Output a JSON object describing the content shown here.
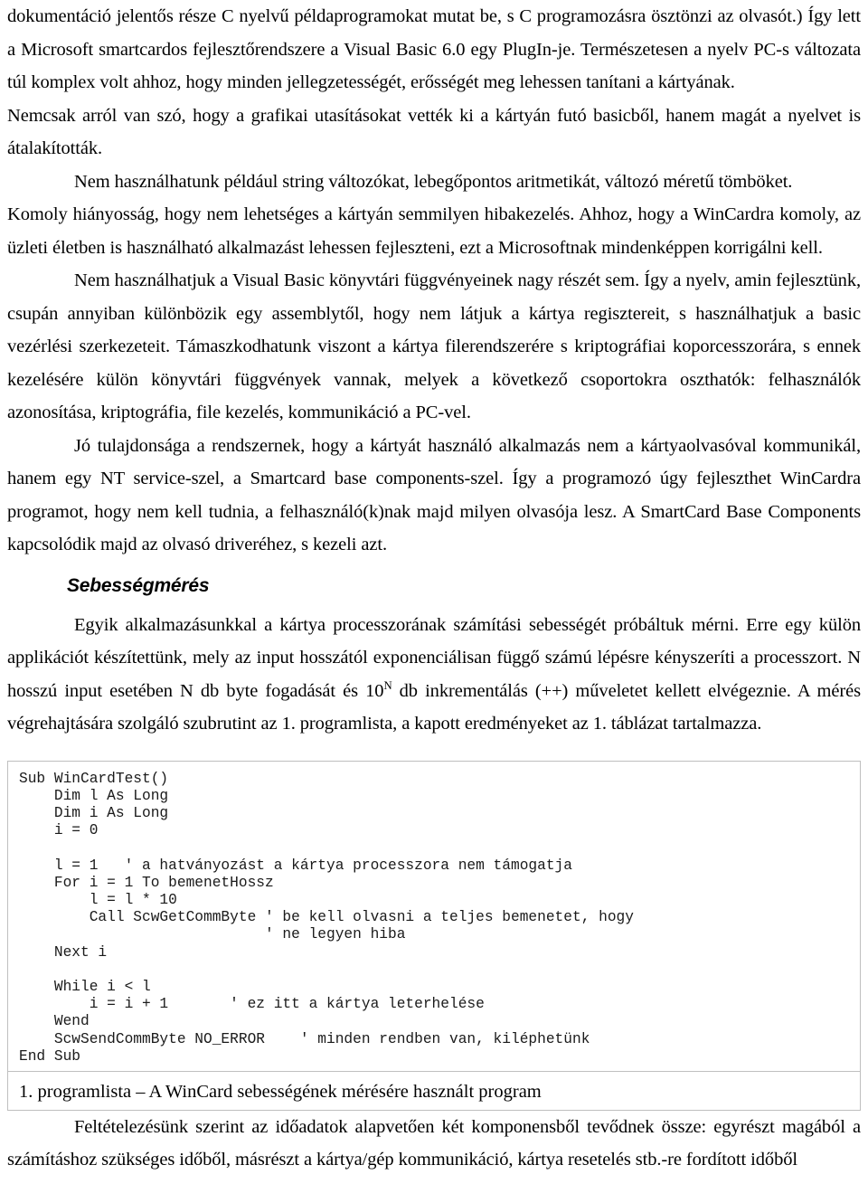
{
  "document": {
    "paragraphs": [
      {
        "id": "para-continuation",
        "text": "dokumentáció jelentős része C nyelvű példaprogramokat mutat be, s C programozásra ösztönzi az olvasót.) Így lett a Microsoft smartcardos fejlesztőrendszere a Visual Basic 6.0 egy PlugIn-je. Természetesen a nyelv PC-s változata túl komplex volt ahhoz, hogy minden jellegzetességét, erősségét meg lehessen tanítani a kártyának."
      },
      {
        "id": "para-nemcsak",
        "text": "Nemcsak arról van szó, hogy a grafikai utasításokat vették ki a kártyán futó basicből, hanem magát a nyelvet is átalakították."
      },
      {
        "id": "para-nem-hasznalhatunk",
        "text": "Nem használhatunk például string változókat, lebegőpontos aritmetikát, változó méretű tömböket."
      },
      {
        "id": "para-komoly-hianyossag",
        "text": "Komoly hiányosság, hogy nem lehetséges a kártyán semmilyen hibakezelés. Ahhoz, hogy a WinCardra komoly, az üzleti életben is használható alkalmazást lehessen fejleszteni, ezt a Microsoftnak mindenképpen korrigálni kell."
      },
      {
        "id": "para-visual-basic-konyvtari",
        "text": "Nem használhatjuk a Visual Basic könyvtári függvényeinek nagy részét sem. Így a nyelv, amin fejlesztünk, csupán annyiban különbözik egy assemblytől, hogy nem látjuk a kártya regisztereit, s használhatjuk a basic vezérlési szerkezeteit. Támaszkodhatunk viszont a kártya filerendszerére s kriptográfiai koporcesszorára, s ennek kezelésére külön könyvtári függvények vannak, melyek a következő csoportokra oszthatók: felhasználók azonosítása, kriptográfia, file kezelés, kommunikáció a PC-vel."
      },
      {
        "id": "para-jo-tulajdonsaga",
        "text": "Jó tulajdonsága a rendszernek, hogy a kártyát használó alkalmazás nem a kártyaolvasóval kommunikál, hanem egy NT service-szel, a Smartcard base components-szel. Így a programozó úgy fejleszthet WinCardra programot, hogy nem kell tudnia, a felhasználó(k)nak majd milyen olvasója lesz. A SmartCard Base Components kapcsolódik majd az olvasó driveréhez, s kezeli azt."
      }
    ],
    "heading": {
      "id": "heading-sebessegmeres",
      "text": "Sebességmérés"
    },
    "speed_section": {
      "para_intro_part1": "Egyik alkalmazásunkkal a kártya processzorának számítási sebességét próbáltuk mérni. Erre egy külön applikációt készítettünk, mely az input hosszától exponenciálisan függő számú lépésre kényszeríti a processzort. N hosszú input esetében N db byte fogadását és 10",
      "superscript": "N",
      "para_intro_part2": " db inkrementálás (++) műveletet kellett elvégeznie. A mérés végrehajtására szolgáló szubrutint az 1. programlista, a kapott eredményeket az 1. táblázat tartalmazza."
    },
    "code_listing": {
      "id": "code-wincardtest",
      "language": "Visual Basic",
      "text": "Sub WinCardTest()\n    Dim l As Long\n    Dim i As Long\n    i = 0\n\n    l = 1   ' a hatványozást a kártya processzora nem támogatja\n    For i = 1 To bemenetHossz\n        l = l * 10\n        Call ScwGetCommByte ' be kell olvasni a teljes bemenetet, hogy\n                            ' ne legyen hiba\n    Next i\n\n    While i < l\n        i = i + 1       ' ez itt a kártya leterhelése\n    Wend\n    ScwSendCommByte NO_ERROR    ' minden rendben van, kiléphetünk\nEnd Sub"
    },
    "caption": {
      "id": "caption-programlista-1",
      "text": "1. programlista – A WinCard sebességének mérésére használt program"
    },
    "closing_paragraph": {
      "id": "para-feltetelezesunk",
      "text": "Feltételezésünk szerint az időadatok alapvetően két komponensből tevődnek össze: egyrészt magából a számításhoz szükséges időből, másrészt a kártya/gép kommunikáció, kártya resetelés stb.-re fordított időből"
    }
  }
}
